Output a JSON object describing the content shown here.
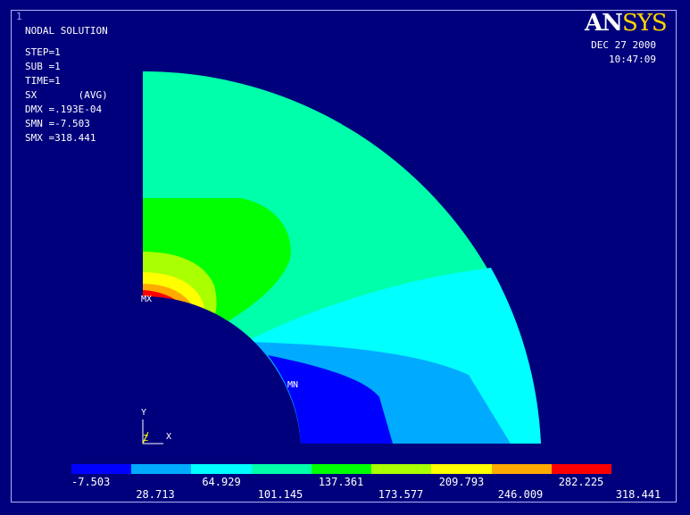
{
  "window_number": "1",
  "title": "NODAL SOLUTION",
  "solution_info": {
    "step": "STEP=1",
    "sub": "SUB =1",
    "time": "TIME=1",
    "component": "SX       (AVG)",
    "dmx": "DMX =.193E-04",
    "smn": "SMN =-7.503",
    "smx": "SMX =318.441"
  },
  "logo": {
    "an": "AN",
    "sys": "SYS"
  },
  "date": "DEC 27 2000",
  "time_of_day": "10:47:09",
  "markers": {
    "max": "MX",
    "min": "MN"
  },
  "axes": {
    "y": "Y",
    "z": "Z",
    "x": "X"
  },
  "legend": {
    "colors": [
      "#0000ff",
      "#00aaff",
      "#00ffff",
      "#00ffaa",
      "#00ff00",
      "#aaff00",
      "#ffff00",
      "#ffaa00",
      "#ff0000"
    ],
    "values_top": [
      "-7.503",
      "64.929",
      "137.361",
      "209.793",
      "282.225"
    ],
    "values_bottom": [
      "28.713",
      "101.145",
      "173.577",
      "246.009",
      "318.441"
    ]
  }
}
